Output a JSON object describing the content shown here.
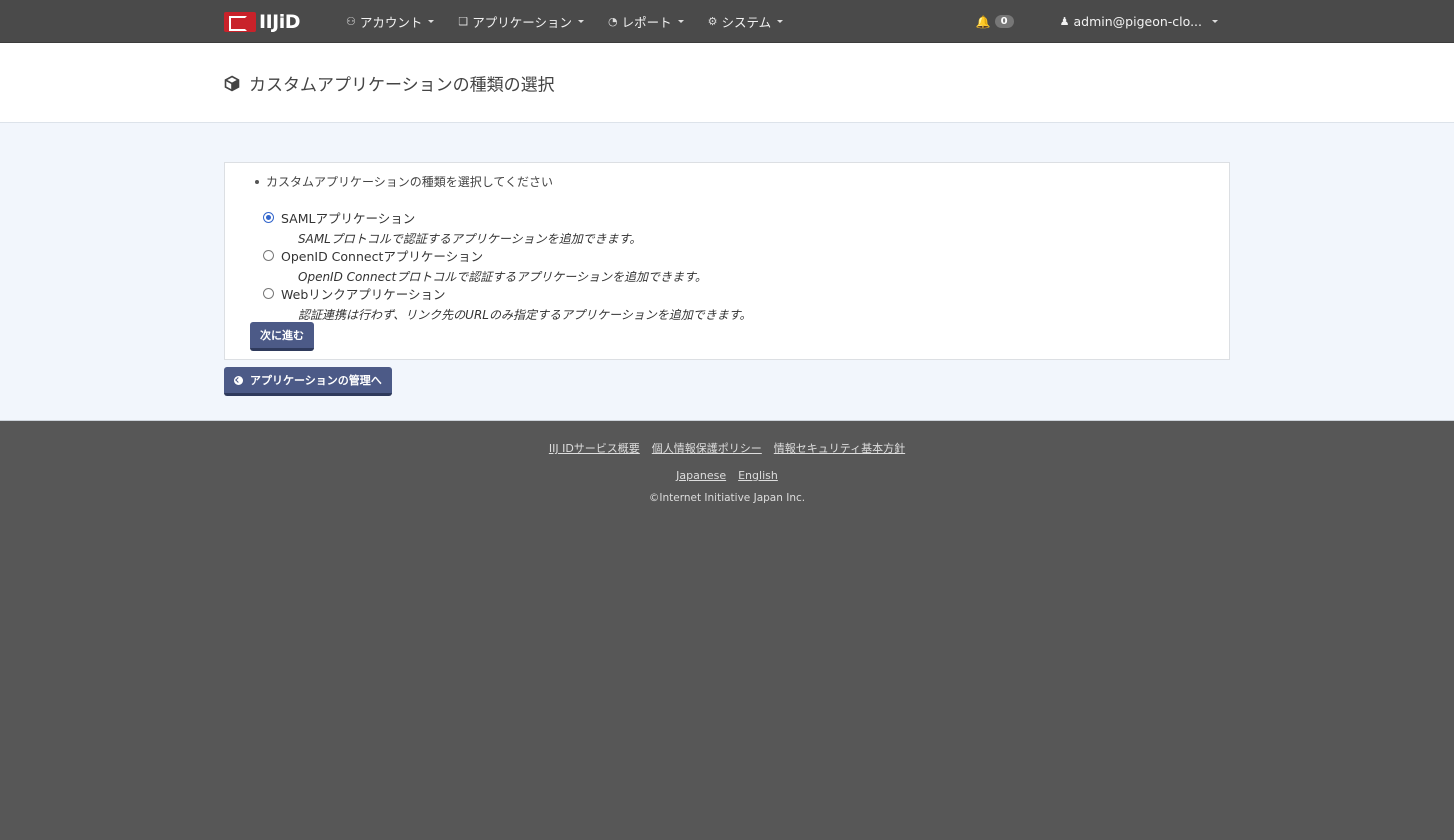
{
  "navbar": {
    "logo_text": "IIJiD",
    "menus": [
      {
        "label": "アカウント",
        "icon": "users-icon"
      },
      {
        "label": "アプリケーション",
        "icon": "cube-icon"
      },
      {
        "label": "レポート",
        "icon": "pie-chart-icon"
      },
      {
        "label": "システム",
        "icon": "gear-icon"
      }
    ],
    "notifications_count": "0",
    "user_label": "admin@pigeon-clo..."
  },
  "header": {
    "title": "カスタムアプリケーションの種類の選択"
  },
  "form": {
    "hint": "カスタムアプリケーションの種類を選択してください",
    "options": [
      {
        "label": "SAMLアプリケーション",
        "description": "SAMLプロトコルで認証するアプリケーションを追加できます。",
        "checked": true
      },
      {
        "label": "OpenID Connectアプリケーション",
        "description": "OpenID Connectプロトコルで認証するアプリケーションを追加できます。",
        "checked": false
      },
      {
        "label": "Webリンクアプリケーション",
        "description": "認証連携は行わず、リンク先のURLのみ指定するアプリケーションを追加できます。",
        "checked": false
      }
    ],
    "next_label": "次に進む"
  },
  "back_label": "アプリケーションの管理へ",
  "footer": {
    "links": [
      "IIJ IDサービス概要",
      "個人情報保護ポリシー",
      "情報セキュリティ基本方針"
    ],
    "languages": [
      "Japanese",
      "English"
    ],
    "copyright": "©Internet Initiative Japan Inc."
  }
}
